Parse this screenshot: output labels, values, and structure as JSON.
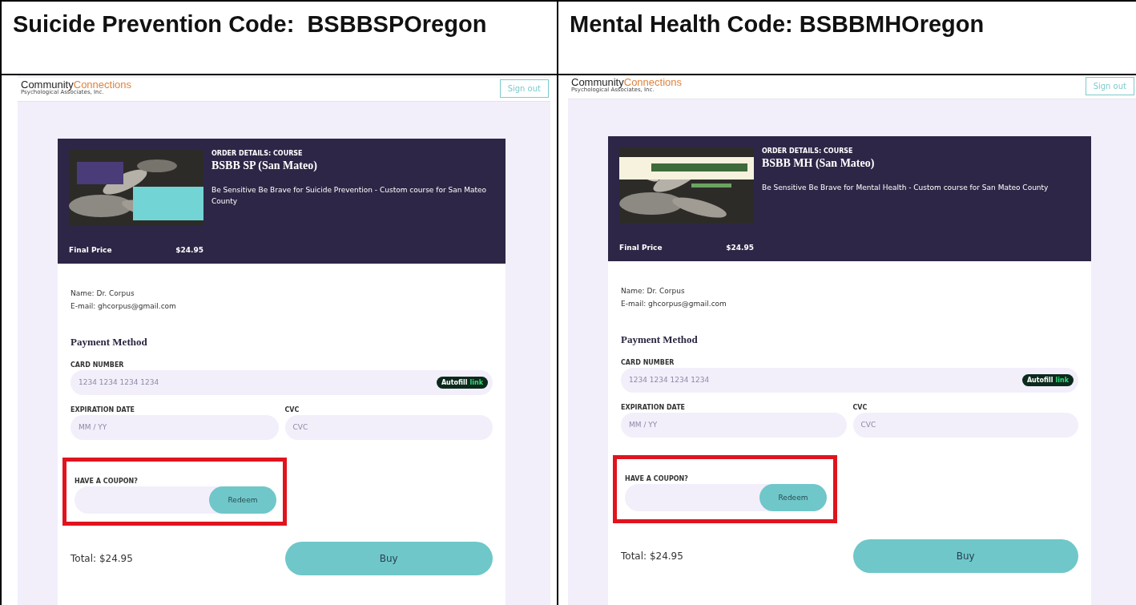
{
  "columns": [
    {
      "heading": "Suicide Prevention Code:  BSBBSPOregon",
      "screenshot": {
        "logo": {
          "first": "Community",
          "second": "Connections",
          "tagline": "Psychological Associates, Inc."
        },
        "sign_out": "Sign out",
        "order": {
          "eyebrow": "ORDER DETAILS: COURSE",
          "title": "BSBB SP (San Mateo)",
          "description": "Be Sensitive Be Brave for Suicide Prevention - Custom course for San Mateo County",
          "price_label": "Final Price",
          "price": "$24.95"
        },
        "customer": {
          "name": "Name: Dr. Corpus",
          "email": "E-mail: ghcorpus@gmail.com"
        },
        "payment": {
          "heading": "Payment Method",
          "card_label": "CARD NUMBER",
          "card_placeholder": "1234 1234 1234 1234",
          "autofill": "Autofill",
          "autofill_brand": "link",
          "expiry_label": "EXPIRATION DATE",
          "expiry_placeholder": "MM / YY",
          "cvc_label": "CVC",
          "cvc_placeholder": "CVC"
        },
        "coupon": {
          "label": "HAVE A COUPON?",
          "button": "Redeem",
          "highlighted": true
        },
        "total": "Total: $24.95",
        "buy": "Buy"
      }
    },
    {
      "heading": "Mental Health Code: BSBBMHOregon",
      "screenshot": {
        "logo": {
          "first": "Community",
          "second": "Connections",
          "tagline": "Psychological Associates, Inc."
        },
        "sign_out": "Sign out",
        "order": {
          "eyebrow": "ORDER DETAILS: COURSE",
          "title": "BSBB MH (San Mateo)",
          "description": "Be Sensitive Be Brave for Mental Health - Custom course for San Mateo County",
          "price_label": "Final Price",
          "price": "$24.95"
        },
        "customer": {
          "name": "Name: Dr. Corpus",
          "email": "E-mail: ghcorpus@gmail.com"
        },
        "payment": {
          "heading": "Payment Method",
          "card_label": "CARD NUMBER",
          "card_placeholder": "1234 1234 1234 1234",
          "autofill": "Autofill",
          "autofill_brand": "link",
          "expiry_label": "EXPIRATION DATE",
          "expiry_placeholder": "MM / YY",
          "cvc_label": "CVC",
          "cvc_placeholder": "CVC"
        },
        "coupon": {
          "label": "HAVE A COUPON?",
          "button": "Redeem",
          "highlighted": true
        },
        "total": "Total: $24.95",
        "buy": "Buy"
      }
    }
  ]
}
